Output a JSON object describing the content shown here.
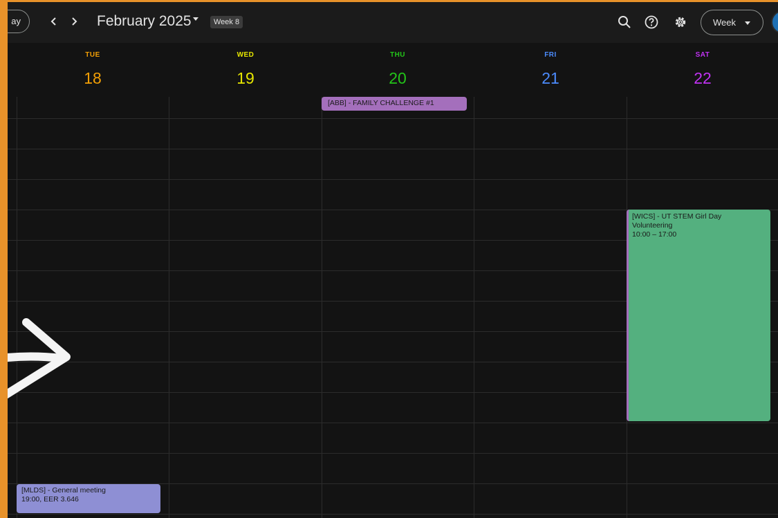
{
  "header": {
    "today_label": "ay",
    "prev_label": "‹",
    "next_label": "›",
    "month_title": "February 2025",
    "week_badge": "Week 8",
    "view_label": "Week"
  },
  "icons": {
    "search": "search-icon",
    "help": "help-icon",
    "settings": "gear-icon"
  },
  "days": [
    {
      "dow": "TUE",
      "num": "18",
      "color": "#f29f05"
    },
    {
      "dow": "WED",
      "num": "19",
      "color": "#e6e600"
    },
    {
      "dow": "THU",
      "num": "20",
      "color": "#23c419"
    },
    {
      "dow": "FRI",
      "num": "21",
      "color": "#4c8cff"
    },
    {
      "dow": "SAT",
      "num": "22",
      "color": "#c032f2"
    }
  ],
  "events": [
    {
      "title": "[ABB] - FAMILY CHALLENGE #1",
      "subtitle": "",
      "color": "#a46fbc"
    },
    {
      "title": "[WICS] - UT STEM Girl Day Volunteering",
      "subtitle": "10:00 – 17:00",
      "color": "#54b07f"
    },
    {
      "title": "[MLDS] - General meeting",
      "subtitle": "19:00, EER 3.646",
      "color": "#8e8fd4"
    }
  ]
}
